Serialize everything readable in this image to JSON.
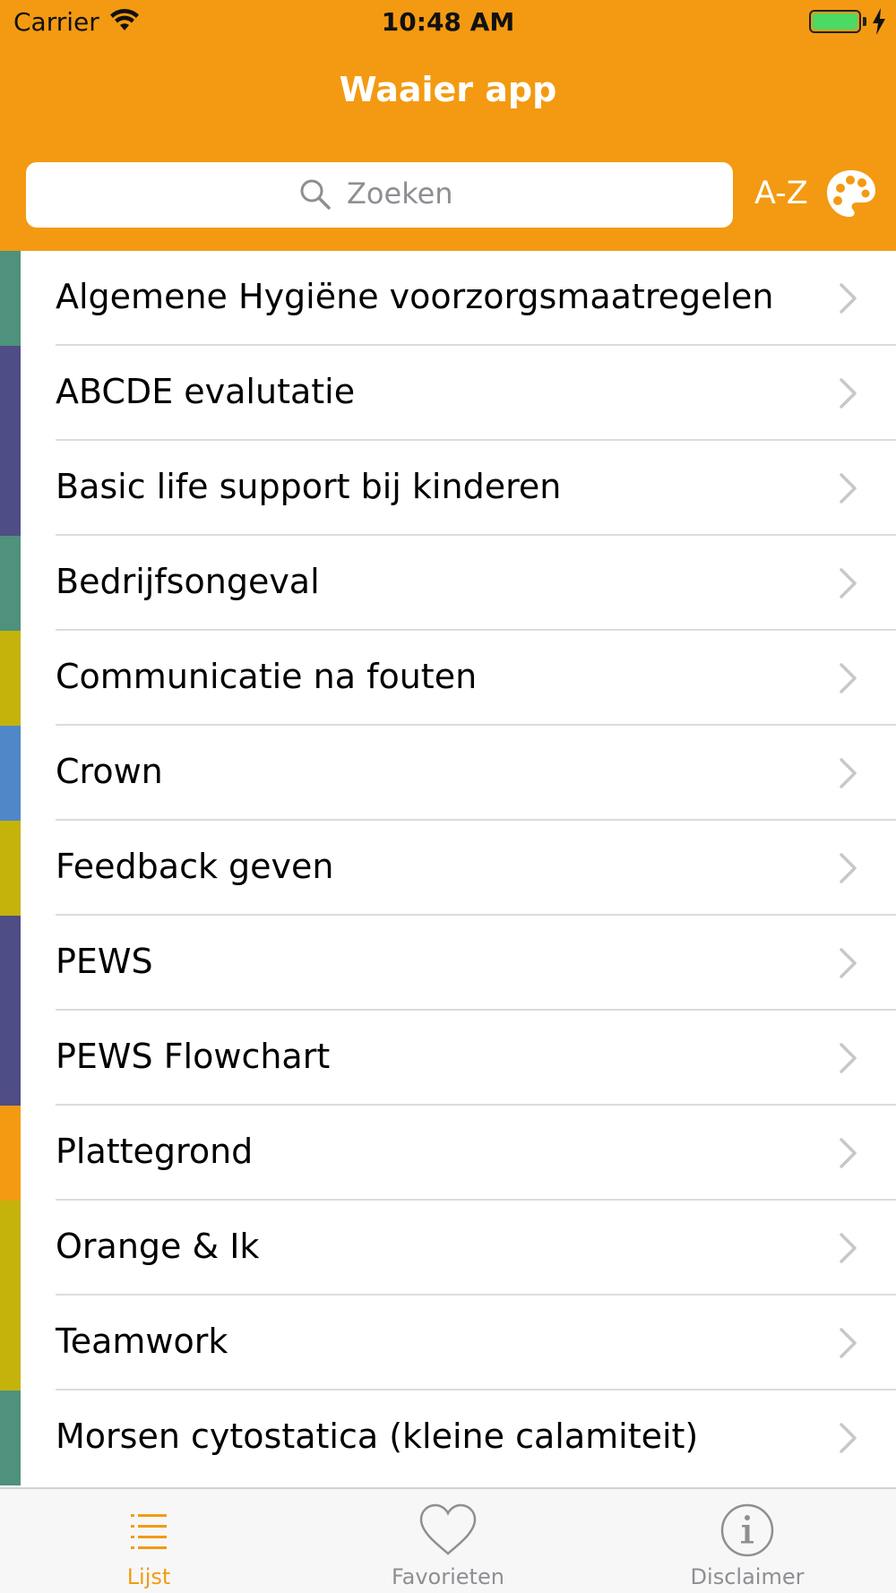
{
  "status_bar": {
    "carrier": "Carrier",
    "time": "10:48 AM"
  },
  "header": {
    "title": "Waaier app",
    "search_placeholder": "Zoeken",
    "sort_label": "A-Z",
    "icons": {
      "search": "search-icon",
      "palette": "palette-icon"
    }
  },
  "colors": {
    "brand": "#f39a12",
    "teal": "#4e917c",
    "purple": "#4f4d85",
    "olive": "#c4b30b",
    "blue": "#4f87c8",
    "orange": "#f39a12"
  },
  "list": {
    "items": [
      {
        "label": "Algemene Hygiëne voorzorgsmaatregelen",
        "color": "#4e917c"
      },
      {
        "label": "ABCDE evalutatie",
        "color": "#4f4d85"
      },
      {
        "label": "Basic life support bij kinderen",
        "color": "#4f4d85"
      },
      {
        "label": "Bedrijfsongeval",
        "color": "#4e917c"
      },
      {
        "label": "Communicatie na fouten",
        "color": "#c4b30b"
      },
      {
        "label": "Crown",
        "color": "#4f87c8"
      },
      {
        "label": "Feedback geven",
        "color": "#c4b30b"
      },
      {
        "label": "PEWS",
        "color": "#4f4d85"
      },
      {
        "label": "PEWS Flowchart",
        "color": "#4f4d85"
      },
      {
        "label": "Plattegrond",
        "color": "#f39a12"
      },
      {
        "label": "Orange & Ik",
        "color": "#c4b30b"
      },
      {
        "label": "Teamwork",
        "color": "#c4b30b"
      },
      {
        "label": "Morsen cytostatica (kleine calamiteit)",
        "color": "#4e917c"
      }
    ]
  },
  "tabbar": {
    "tabs": [
      {
        "label": "Lijst",
        "icon": "list-icon",
        "active": true
      },
      {
        "label": "Favorieten",
        "icon": "heart-icon",
        "active": false
      },
      {
        "label": "Disclaimer",
        "icon": "info-icon",
        "active": false
      }
    ]
  }
}
